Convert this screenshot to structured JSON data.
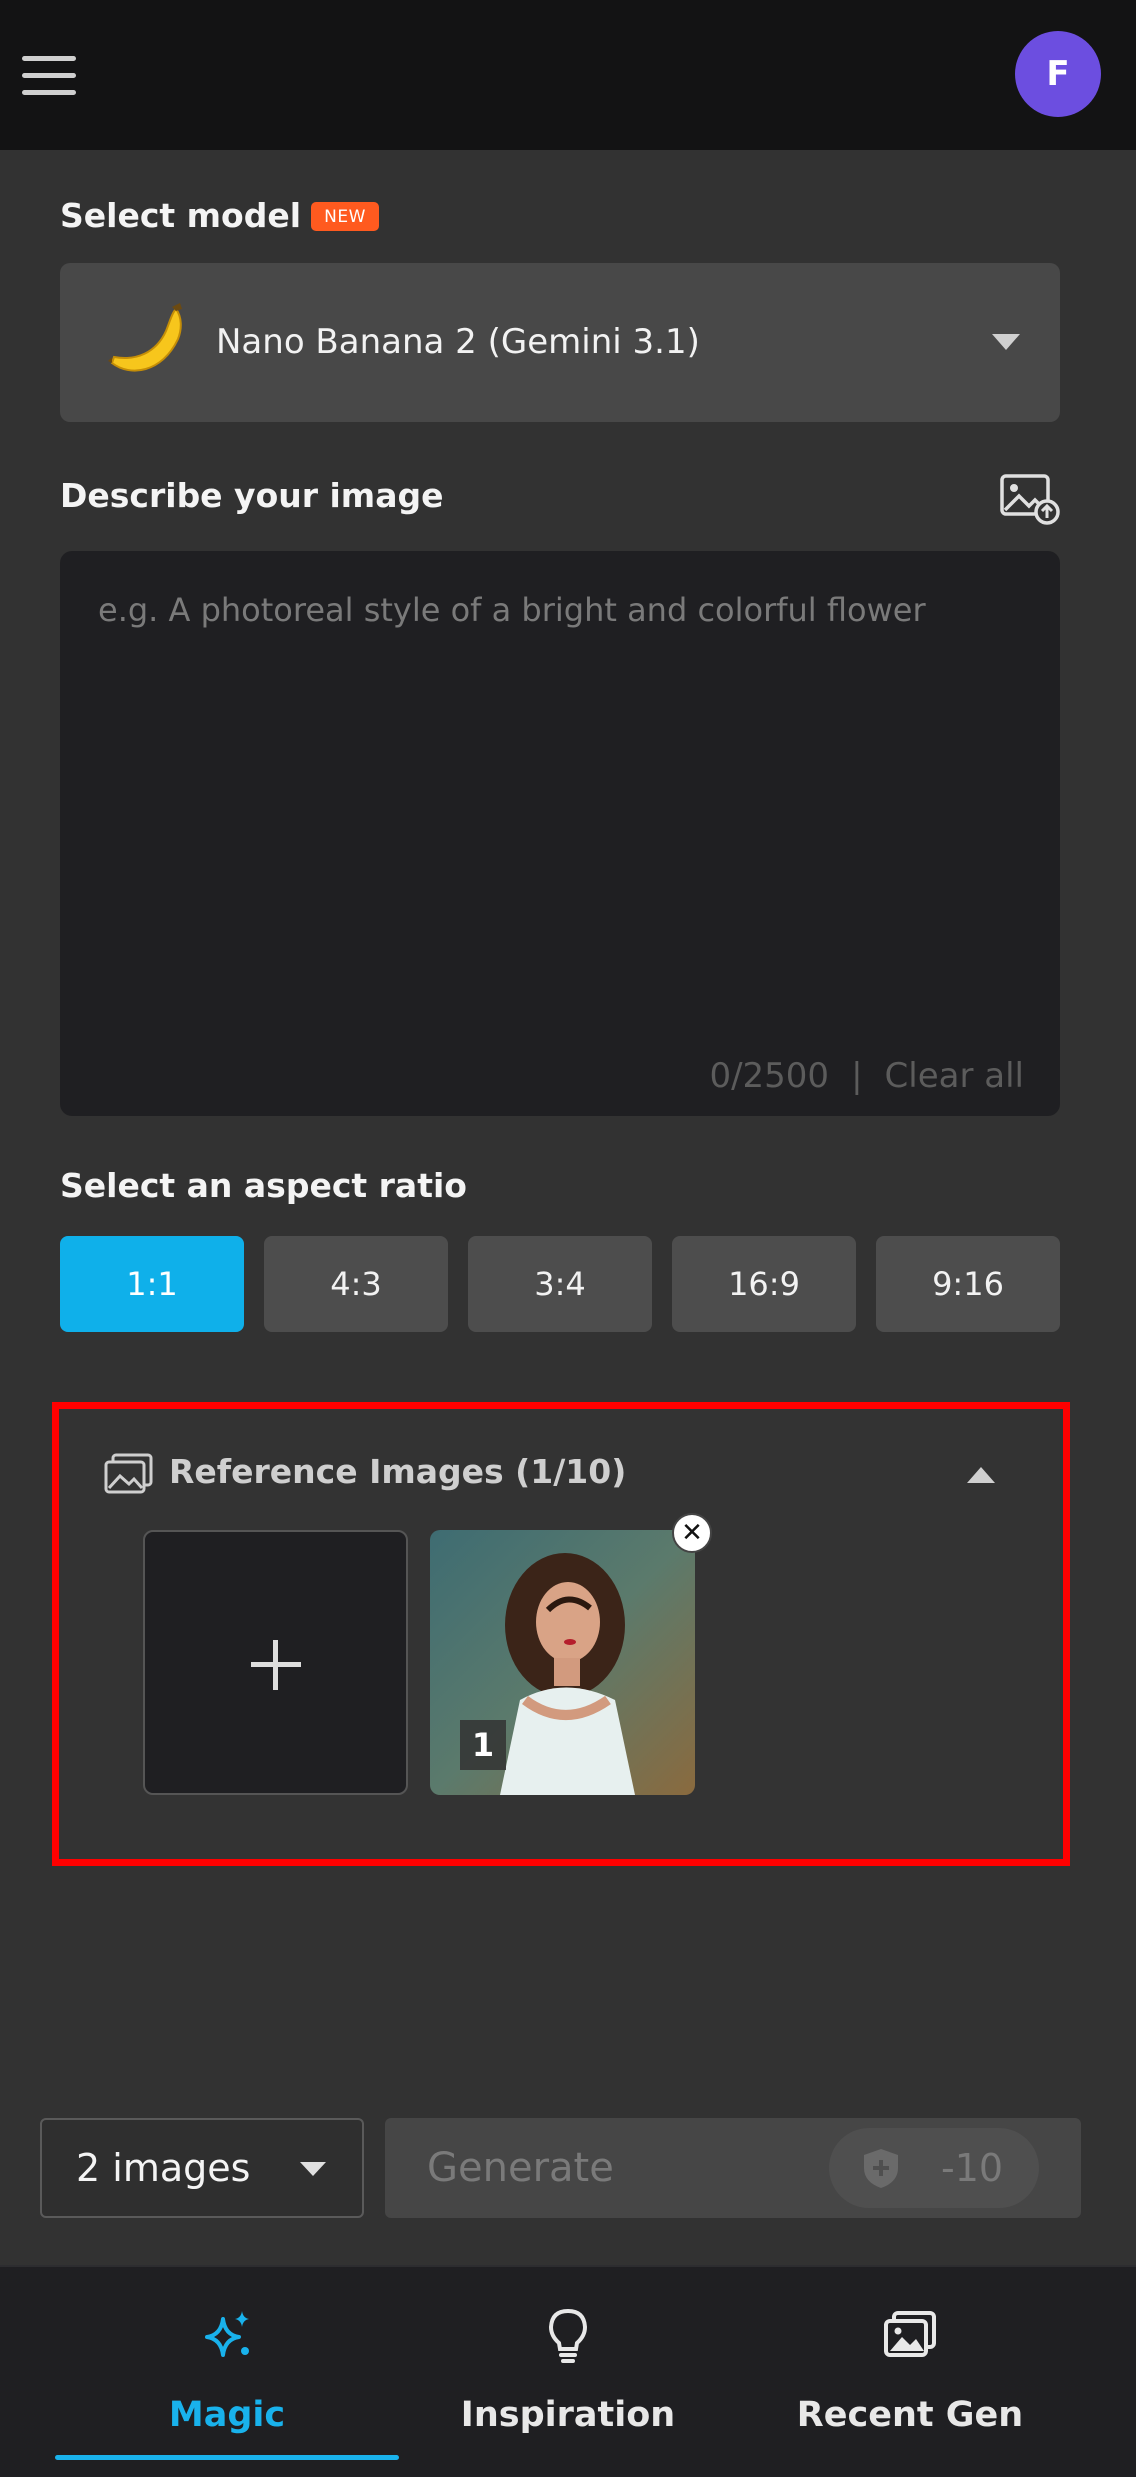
{
  "header": {
    "avatar_letter": "F"
  },
  "model": {
    "label": "Select model",
    "badge": "NEW",
    "selected": "Nano Banana 2 (Gemini 3.1)"
  },
  "prompt": {
    "label": "Describe your image",
    "placeholder": "e.g. A photoreal style of a bright and colorful flower",
    "counter": "0/2500",
    "separator": "|",
    "clear_label": "Clear all"
  },
  "aspect": {
    "label": "Select an aspect ratio",
    "options": [
      "1:1",
      "4:3",
      "3:4",
      "16:9",
      "9:16"
    ],
    "selected": "1:1"
  },
  "reference": {
    "title": "Reference Images (1/10)",
    "thumb_number": "1"
  },
  "actions": {
    "count_selected": "2 images",
    "generate_label": "Generate",
    "cost": "-10"
  },
  "nav": {
    "items": [
      {
        "label": "Magic",
        "icon": "sparkle-icon",
        "active": true
      },
      {
        "label": "Inspiration",
        "icon": "lightbulb-icon",
        "active": false
      },
      {
        "label": "Recent Gen",
        "icon": "gallery-icon",
        "active": false
      }
    ]
  },
  "colors": {
    "accent": "#19b2ec",
    "badge": "#ff5a1f",
    "avatar": "#6c4ee0",
    "highlight_border": "#ff0000"
  }
}
